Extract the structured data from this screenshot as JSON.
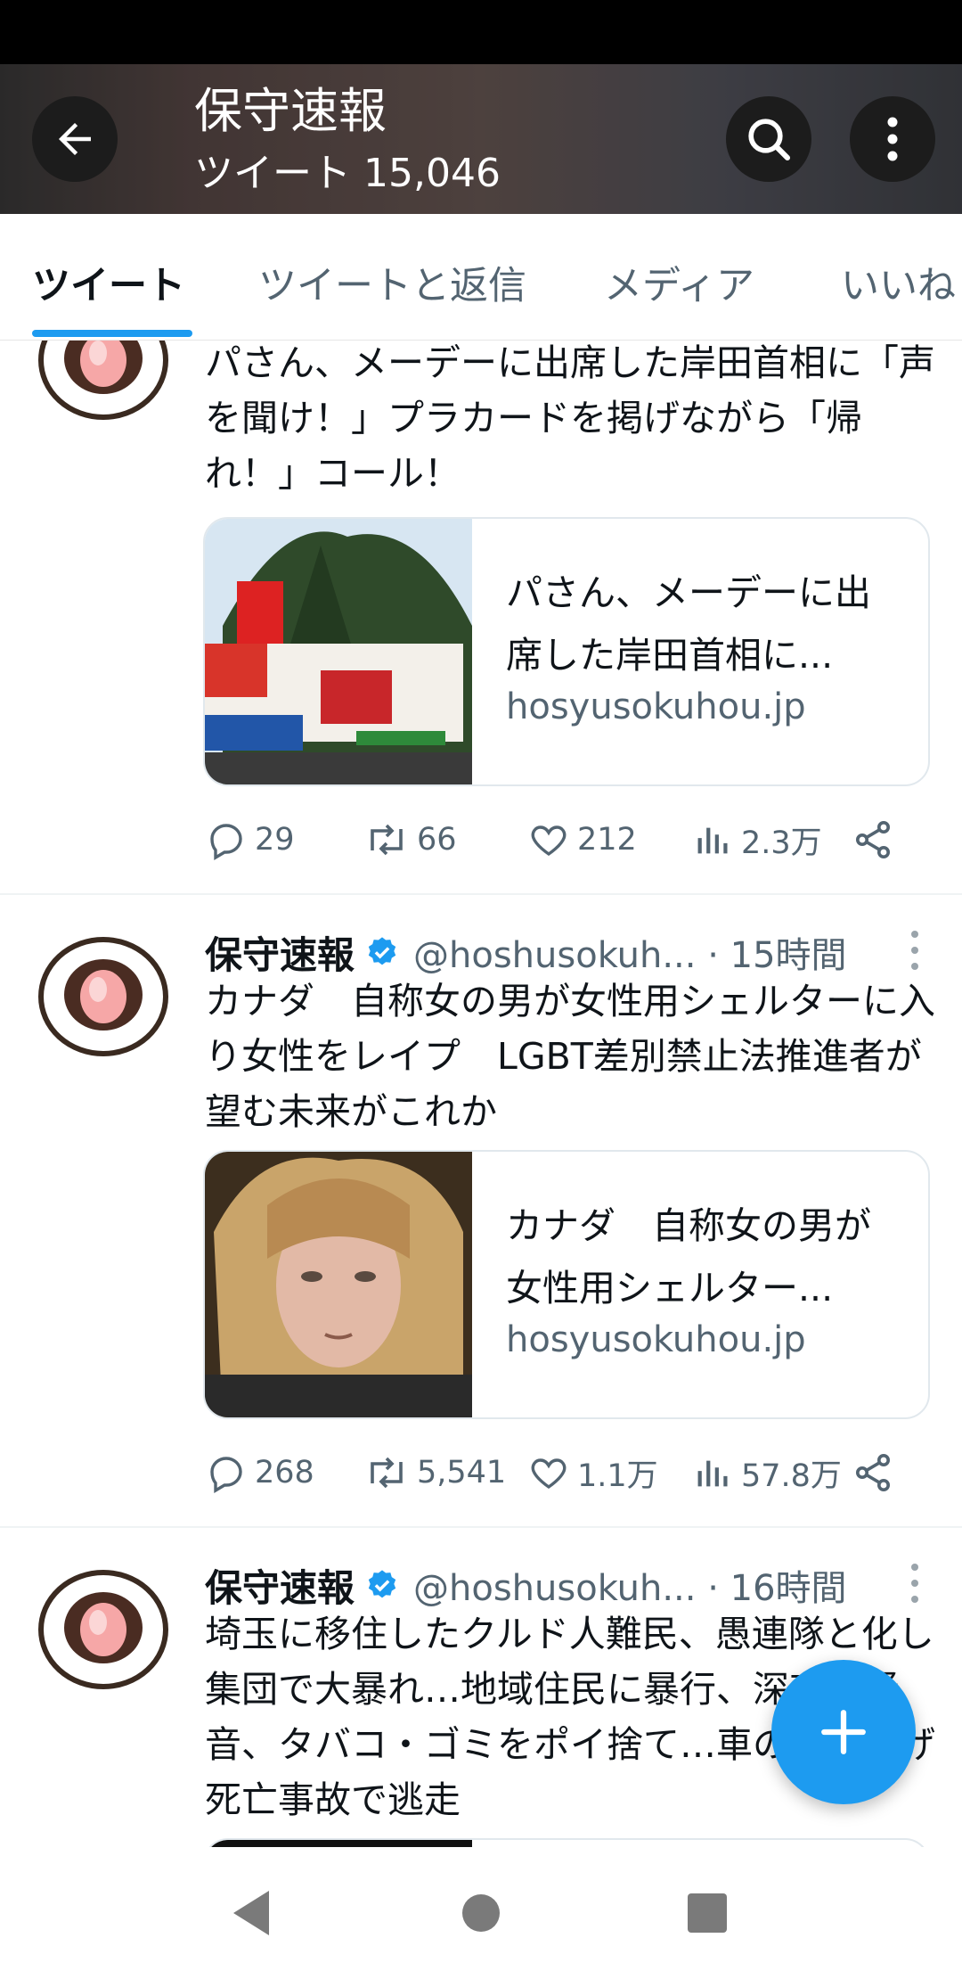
{
  "header": {
    "title": "保守速報",
    "tweet_count": "ツイート 15,046",
    "back_icon": "arrow-left-icon",
    "search_icon": "search-icon",
    "more_icon": "more-vertical-icon"
  },
  "tabs": [
    {
      "label": "ツイート",
      "active": true
    },
    {
      "label": "ツイートと返信",
      "active": false
    },
    {
      "label": "メディア",
      "active": false
    },
    {
      "label": "いいね",
      "active": false
    }
  ],
  "tweets": [
    {
      "text": "パさん、メーデーに出席した岸田首相に「声を聞け！」プラカードを掲げながら「帰れ！」コール！",
      "card": {
        "title": "パさん、メーデーに出席した岸田首相に...",
        "domain": "hosyusokuhou.jp"
      },
      "stats": {
        "replies": "29",
        "retweets": "66",
        "likes": "212",
        "views": "2.3万"
      }
    },
    {
      "author": "保守速報",
      "handle": "@hoshusokuh... · 15時間",
      "text": "カナダ　自称女の男が女性用シェルターに入り女性をレイプ　LGBT差別禁止法推進者が望む未来がこれか",
      "card": {
        "title": "カナダ　自称女の男が女性用シェルター...",
        "domain": "hosyusokuhou.jp"
      },
      "stats": {
        "replies": "268",
        "retweets": "5,541",
        "likes": "1.1万",
        "views": "57.8万"
      }
    },
    {
      "author": "保守速報",
      "handle": "@hoshusokuh... · 16時間",
      "text": "埼玉に移住したクルド人難民、愚連隊と化し集団で大暴れ…地域住民に暴行、深夜の騒音、タバコ・ゴミをポイ捨て…車のひき逃げ死亡事故で逃走"
    }
  ],
  "colors": {
    "accent": "#1d9bf0",
    "text": "#0f1419",
    "secondary": "#536471"
  },
  "fab": {
    "icon": "plus-icon"
  },
  "nav": {
    "back": "nav-back-icon",
    "home": "nav-home-icon",
    "recents": "nav-recents-icon"
  }
}
